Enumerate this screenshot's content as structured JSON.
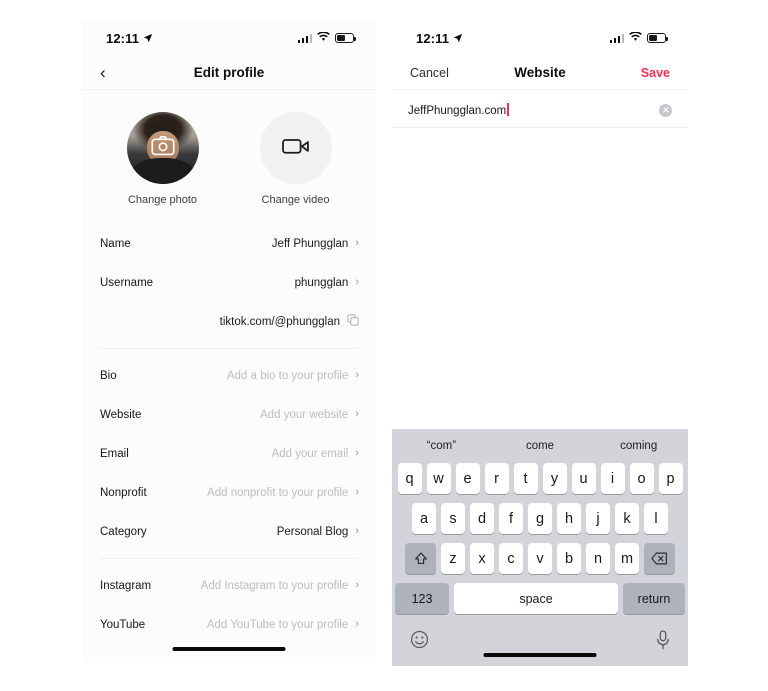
{
  "left_phone": {
    "status": {
      "time": "12:11",
      "location_icon": "location-arrow-icon",
      "signal_icon": "cellular-signal-icon",
      "wifi_icon": "wifi-icon",
      "battery_icon": "battery-icon",
      "battery_level": "50"
    },
    "nav": {
      "back_icon": "back-chevron-icon",
      "title": "Edit profile"
    },
    "media": {
      "photo_label": "Change photo",
      "photo_icon": "camera-icon",
      "video_label": "Change video",
      "video_icon": "video-camera-icon"
    },
    "fields": [
      {
        "label": "Name",
        "value": "Jeff Phungglan",
        "placeholder": false,
        "accessory": "chevron"
      },
      {
        "label": "Username",
        "value": "phungglan",
        "placeholder": false,
        "accessory": "chevron"
      },
      {
        "label": "",
        "value": "tiktok.com/@phungglan",
        "placeholder": false,
        "accessory": "copy"
      },
      {
        "label": "Bio",
        "value": "Add a bio to your profile",
        "placeholder": true,
        "accessory": "chevron"
      },
      {
        "label": "Website",
        "value": "Add your website",
        "placeholder": true,
        "accessory": "chevron"
      },
      {
        "label": "Email",
        "value": "Add your email",
        "placeholder": true,
        "accessory": "chevron"
      },
      {
        "label": "Nonprofit",
        "value": "Add nonprofit to your profile",
        "placeholder": true,
        "accessory": "chevron"
      },
      {
        "label": "Category",
        "value": "Personal Blog",
        "placeholder": false,
        "accessory": "chevron"
      }
    ],
    "social_fields": [
      {
        "label": "Instagram",
        "value": "Add Instagram to your profile",
        "placeholder": true,
        "accessory": "chevron"
      },
      {
        "label": "YouTube",
        "value": "Add YouTube to your profile",
        "placeholder": true,
        "accessory": "chevron"
      }
    ]
  },
  "right_phone": {
    "status": {
      "time": "12:11",
      "location_icon": "location-arrow-icon",
      "signal_icon": "cellular-signal-icon",
      "wifi_icon": "wifi-icon",
      "battery_icon": "battery-icon",
      "battery_level": "50"
    },
    "nav": {
      "cancel_label": "Cancel",
      "title": "Website",
      "save_label": "Save",
      "save_color": "#fe2c55"
    },
    "input": {
      "value": "JeffPhungglan.com",
      "placeholder": "Add your website",
      "clear_icon": "clear-circle-icon",
      "caret_color": "#fe2c55"
    },
    "keyboard": {
      "suggestions": [
        "“com”",
        "come",
        "coming"
      ],
      "row1": [
        "q",
        "w",
        "e",
        "r",
        "t",
        "y",
        "u",
        "i",
        "o",
        "p"
      ],
      "row2": [
        "a",
        "s",
        "d",
        "f",
        "g",
        "h",
        "j",
        "k",
        "l"
      ],
      "row3": [
        "z",
        "x",
        "c",
        "v",
        "b",
        "n",
        "m"
      ],
      "shift_icon": "shift-arrow-icon",
      "backspace_icon": "backspace-icon",
      "numbers_label": "123",
      "space_label": "space",
      "return_label": "return",
      "emoji_icon": "emoji-smiley-icon",
      "mic_icon": "microphone-icon"
    }
  }
}
